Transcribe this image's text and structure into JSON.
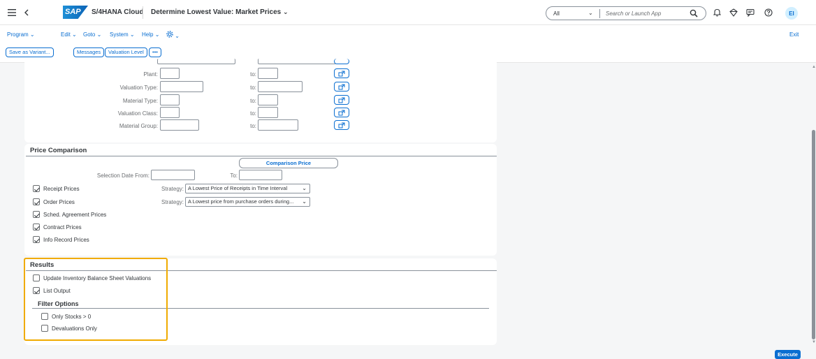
{
  "shell": {
    "product": "S/4HANA Cloud",
    "logo_text": "SAP",
    "app_title": "Determine Lowest Value: Market Prices",
    "search_scope": "All",
    "search_placeholder": "Search or Launch App",
    "avatar": "EI"
  },
  "menu": {
    "items": [
      "Program",
      "Edit",
      "Goto",
      "System",
      "Help"
    ],
    "exit": "Exit"
  },
  "toolbar": {
    "save_variant": "Save as Variant...",
    "messages": "Messages",
    "valuation_level": "Valuation Level",
    "more": "•••"
  },
  "selection": {
    "rows": [
      {
        "label": "Plant:",
        "to": "to:"
      },
      {
        "label": "Valuation Type:",
        "to": "to:"
      },
      {
        "label": "Material Type:",
        "to": "to:"
      },
      {
        "label": "Valuation Class:",
        "to": "to:"
      },
      {
        "label": "Material Group:",
        "to": "to:"
      }
    ]
  },
  "price_comparison": {
    "title": "Price Comparison",
    "comparison_price_button": "Comparison Price",
    "selection_date_from": "Selection Date From:",
    "to": "To:",
    "checkboxes": [
      {
        "label": "Receipt Prices",
        "checked": true
      },
      {
        "label": "Order Prices",
        "checked": true
      },
      {
        "label": "Sched. Agreement Prices",
        "checked": true
      },
      {
        "label": "Contract Prices",
        "checked": true
      },
      {
        "label": "Info Record Prices",
        "checked": true
      }
    ],
    "strategy_label": "Strategy:",
    "strategy_receipt": "A Lowest Price of Receipts in Time Interval",
    "strategy_order": "A Lowest price from purchase orders during..."
  },
  "results": {
    "title": "Results",
    "update_inventory": {
      "label": "Update Inventory Balance Sheet Valuations",
      "checked": false
    },
    "list_output": {
      "label": "List Output",
      "checked": true
    },
    "filter_title": "Filter Options",
    "only_stocks": {
      "label": "Only Stocks > 0",
      "checked": false
    },
    "devaluations": {
      "label": "Devaluations Only",
      "checked": false
    }
  },
  "footer": {
    "execute": "Execute"
  }
}
